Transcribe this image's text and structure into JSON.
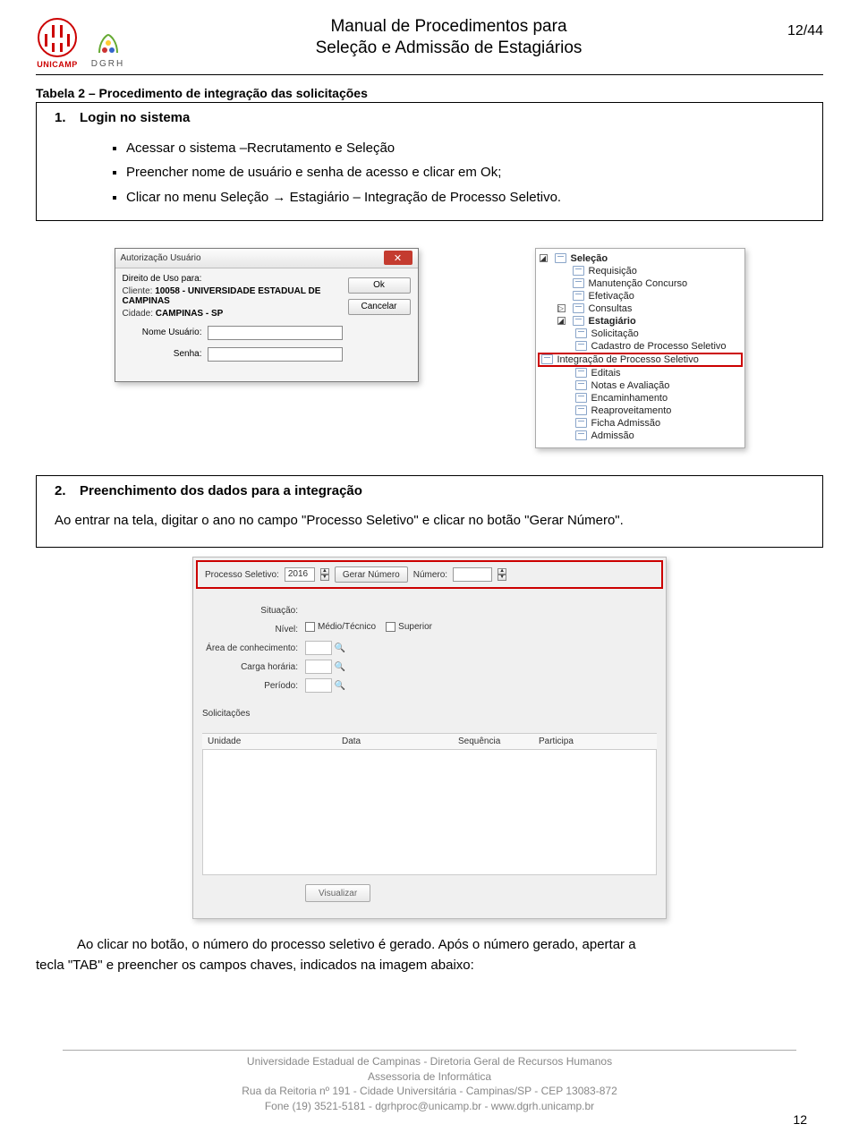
{
  "header": {
    "unicamp_label": "UNICAMP",
    "dgrh_label": "DGRH",
    "title_line1": "Manual de Procedimentos para",
    "title_line2": "Seleção e Admissão de Estagiários",
    "page_indicator": "12/44"
  },
  "table_caption": "Tabela 2 – Procedimento de integração das solicitações",
  "step1": {
    "num": "1.",
    "title": "Login no sistema",
    "bullets": [
      "Acessar o sistema –Recrutamento e Seleção",
      "Preencher nome de usuário e senha de acesso e clicar em Ok;",
      "Clicar no menu Seleção → Estagiário – Integração de Processo Seletivo."
    ]
  },
  "login_dialog": {
    "title": "Autorização Usuário",
    "right_label": "Direito de Uso para:",
    "client_label": "Cliente:",
    "client_value": "10058 - UNIVERSIDADE ESTADUAL DE CAMPINAS",
    "city_label": "Cidade:",
    "city_value": "CAMPINAS - SP",
    "user_label": "Nome Usuário:",
    "pass_label": "Senha:",
    "ok": "Ok",
    "cancel": "Cancelar"
  },
  "tree": {
    "root": "Seleção",
    "items_l1": [
      "Requisição",
      "Manutenção Concurso",
      "Efetivação",
      "Consultas",
      "Estagiário"
    ],
    "items_l2": [
      "Solicitação",
      "Cadastro de Processo Seletivo",
      "Integração de Processo Seletivo",
      "Editais",
      "Notas e Avaliação",
      "Encaminhamento",
      "Reaproveitamento",
      "Ficha Admissão",
      "Admissão"
    ],
    "highlight_index": 2
  },
  "step2": {
    "num": "2.",
    "title": "Preenchimento dos dados para a integração",
    "intro": "Ao entrar na tela, digitar o ano no campo \"Processo Seletivo\" e clicar no botão \"Gerar Número\"."
  },
  "form": {
    "top": {
      "proc_label": "Processo Seletivo:",
      "proc_value": "2016",
      "btn": "Gerar Número",
      "num_label": "Número:"
    },
    "labels": {
      "situacao": "Situação:",
      "nivel": "Nível:",
      "medio": "Médio/Técnico",
      "superior": "Superior",
      "area": "Área de conhecimento:",
      "carga": "Carga horária:",
      "periodo": "Período:",
      "solicitacoes": "Solicitações"
    },
    "columns": [
      "Unidade",
      "Data",
      "Sequência",
      "Participa"
    ],
    "visualizar": "Visualizar"
  },
  "closing": {
    "p1a": "Ao clicar no botão, o número do processo seletivo é gerado. Após o número gerado, apertar a",
    "p1b": "tecla \"TAB\" e preencher os campos chaves, indicados na imagem abaixo:"
  },
  "footer": {
    "l1": "Universidade Estadual de Campinas - Diretoria Geral de Recursos Humanos",
    "l2": "Assessoria de Informática",
    "l3": "Rua da Reitoria nº 191 - Cidade Universitária - Campinas/SP - CEP 13083-872",
    "l4": "Fone (19) 3521-5181 - dgrhproc@unicamp.br - www.dgrh.unicamp.br",
    "page": "12"
  }
}
